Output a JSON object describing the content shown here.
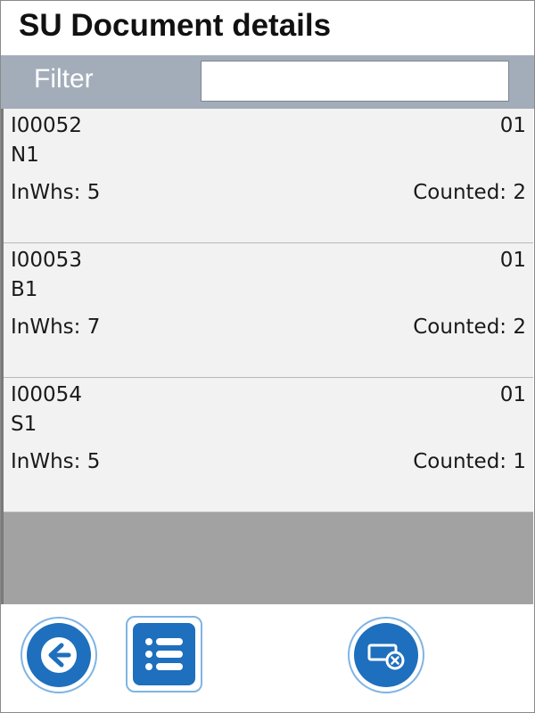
{
  "header": {
    "title": "SU Document details"
  },
  "filter": {
    "label": "Filter",
    "value": ""
  },
  "items": [
    {
      "code": "I00052",
      "number": "01",
      "name": "N1",
      "in_whs": "InWhs: 5",
      "counted": "Counted: 2"
    },
    {
      "code": "I00053",
      "number": "01",
      "name": "B1",
      "in_whs": "InWhs: 7",
      "counted": "Counted: 2"
    },
    {
      "code": "I00054",
      "number": "01",
      "name": "S1",
      "in_whs": "InWhs: 5",
      "counted": "Counted: 1"
    }
  ],
  "footer": {
    "icons": [
      "back-arrow-icon",
      "list-icon",
      "delete-document-icon"
    ]
  },
  "colors": {
    "accent": "#1e6fbd",
    "filter_bar": "#a3adb9",
    "list_empty": "#a2a2a2"
  }
}
